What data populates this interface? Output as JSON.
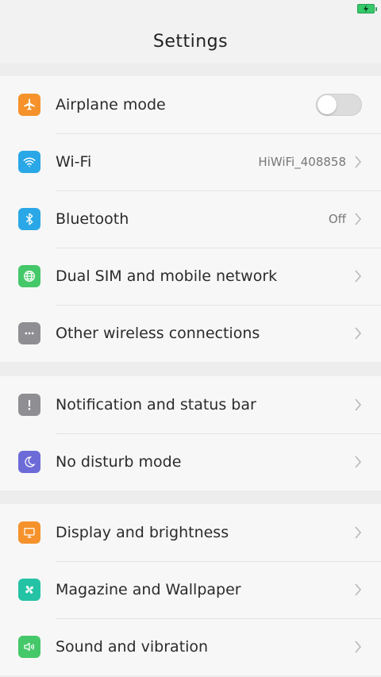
{
  "header": {
    "title": "Settings"
  },
  "colors": {
    "airplane": "#f5922b",
    "wifi": "#2aa7e6",
    "bluetooth": "#2aa7e6",
    "network": "#45c869",
    "other": "#8e8e93",
    "notification": "#8e8e93",
    "disturb": "#6d6bd8",
    "display": "#f5922b",
    "magazine": "#25c3a5",
    "sound": "#45c869"
  },
  "groups": [
    {
      "items": [
        {
          "label": "Airplane mode",
          "icon": "airplane-icon",
          "toggle": false
        },
        {
          "label": "Wi-Fi",
          "icon": "wifi-icon",
          "value": "HiWiFi_408858"
        },
        {
          "label": "Bluetooth",
          "icon": "bluetooth-icon",
          "value": "Off"
        },
        {
          "label": "Dual SIM and mobile network",
          "icon": "globe-icon"
        },
        {
          "label": "Other wireless connections",
          "icon": "more-icon"
        }
      ]
    },
    {
      "items": [
        {
          "label": "Notification and status bar",
          "icon": "exclamation-icon"
        },
        {
          "label": "No disturb mode",
          "icon": "moon-icon"
        }
      ]
    },
    {
      "items": [
        {
          "label": "Display and brightness",
          "icon": "monitor-icon"
        },
        {
          "label": "Magazine and Wallpaper",
          "icon": "pinwheel-icon"
        },
        {
          "label": "Sound and vibration",
          "icon": "speaker-icon"
        }
      ]
    }
  ]
}
